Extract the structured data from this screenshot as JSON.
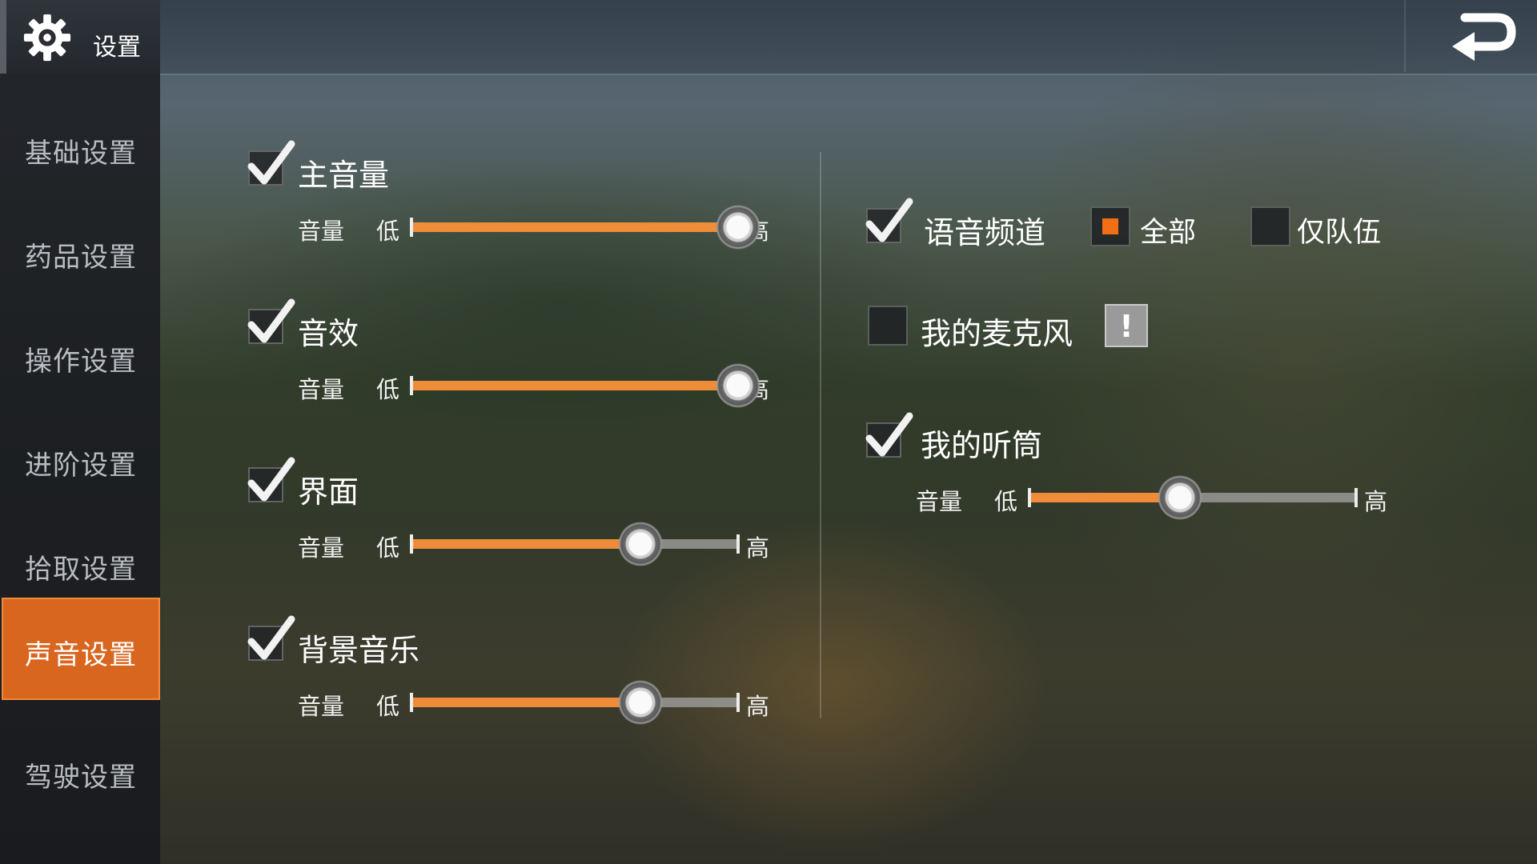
{
  "header": {
    "title": "设置",
    "icon": "gear-icon",
    "back_icon": "back-arrow-icon"
  },
  "sidebar": {
    "items": [
      {
        "label": "基础设置",
        "active": false
      },
      {
        "label": "药品设置",
        "active": false
      },
      {
        "label": "操作设置",
        "active": false
      },
      {
        "label": "进阶设置",
        "active": false
      },
      {
        "label": "拾取设置",
        "active": false
      },
      {
        "label": "声音设置",
        "active": true
      },
      {
        "label": "驾驶设置",
        "active": false
      }
    ]
  },
  "colors": {
    "accent": "#d9661f",
    "slider_fill": "#ef8c3a",
    "option_selected": "#f36f16"
  },
  "left_panel": {
    "sections": [
      {
        "title": "主音量",
        "checked": true,
        "volume_label": "音量",
        "low": "低",
        "high": "高",
        "value": 1.0
      },
      {
        "title": "音效",
        "checked": true,
        "volume_label": "音量",
        "low": "低",
        "high": "高",
        "value": 1.0
      },
      {
        "title": "界面",
        "checked": true,
        "volume_label": "音量",
        "low": "低",
        "high": "高",
        "value": 0.7
      },
      {
        "title": "背景音乐",
        "checked": true,
        "volume_label": "音量",
        "low": "低",
        "high": "高",
        "value": 0.7
      }
    ]
  },
  "right_panel": {
    "voice_channel": {
      "title": "语音频道",
      "checked": true,
      "options": [
        {
          "label": "全部",
          "selected": true
        },
        {
          "label": "仅队伍",
          "selected": false
        }
      ]
    },
    "microphone": {
      "title": "我的麦克风",
      "checked": false,
      "warning": "!"
    },
    "speaker": {
      "title": "我的听筒",
      "checked": true,
      "volume_label": "音量",
      "low": "低",
      "high": "高",
      "value": 0.46
    }
  }
}
